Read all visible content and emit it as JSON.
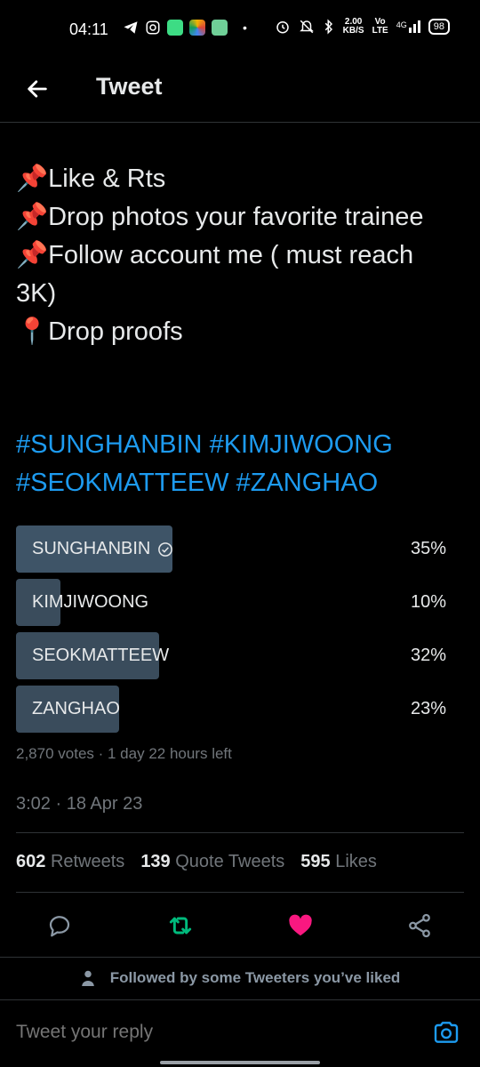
{
  "status_bar": {
    "time": "04:11",
    "net_speed_top": "2.00",
    "net_speed_bottom": "KB/S",
    "volte_top": "Vo",
    "volte_bottom": "LTE",
    "signal": "4G",
    "battery": "98"
  },
  "header": {
    "title": "Tweet"
  },
  "tweet": {
    "text": "📌Like & Rts\n📌Drop photos your favorite trainee\n📌Follow account me ( must reach 3K)\n📍Drop proofs",
    "hashtags": [
      "#SUNGHANBIN",
      "#KIMJIWOONG",
      "#SEOKMATTEEW",
      "#ZANGHAO"
    ]
  },
  "poll": {
    "options": [
      {
        "label": "SUNGHANBIN",
        "percent_text": "35%",
        "fraction": 0.35,
        "winner": true
      },
      {
        "label": "KIMJIWOONG",
        "percent_text": "10%",
        "fraction": 0.1,
        "winner": false
      },
      {
        "label": "SEOKMATTEEW",
        "percent_text": "32%",
        "fraction": 0.32,
        "winner": false
      },
      {
        "label": "ZANGHAO",
        "percent_text": "23%",
        "fraction": 0.23,
        "winner": false
      }
    ],
    "meta": "2,870 votes · 1 day 22 hours left"
  },
  "timestamp": "3:02 · 18 Apr 23",
  "stats": {
    "retweets_count": "602",
    "retweets_label": "Retweets",
    "quotes_count": "139",
    "quotes_label": "Quote Tweets",
    "likes_count": "595",
    "likes_label": "Likes"
  },
  "followed_text": "Followed by some Tweeters you’ve liked",
  "reply": {
    "placeholder": "Tweet your reply"
  },
  "colors": {
    "accent": "#1d9bf0",
    "like": "#f91880",
    "retweet": "#00ba7c"
  }
}
